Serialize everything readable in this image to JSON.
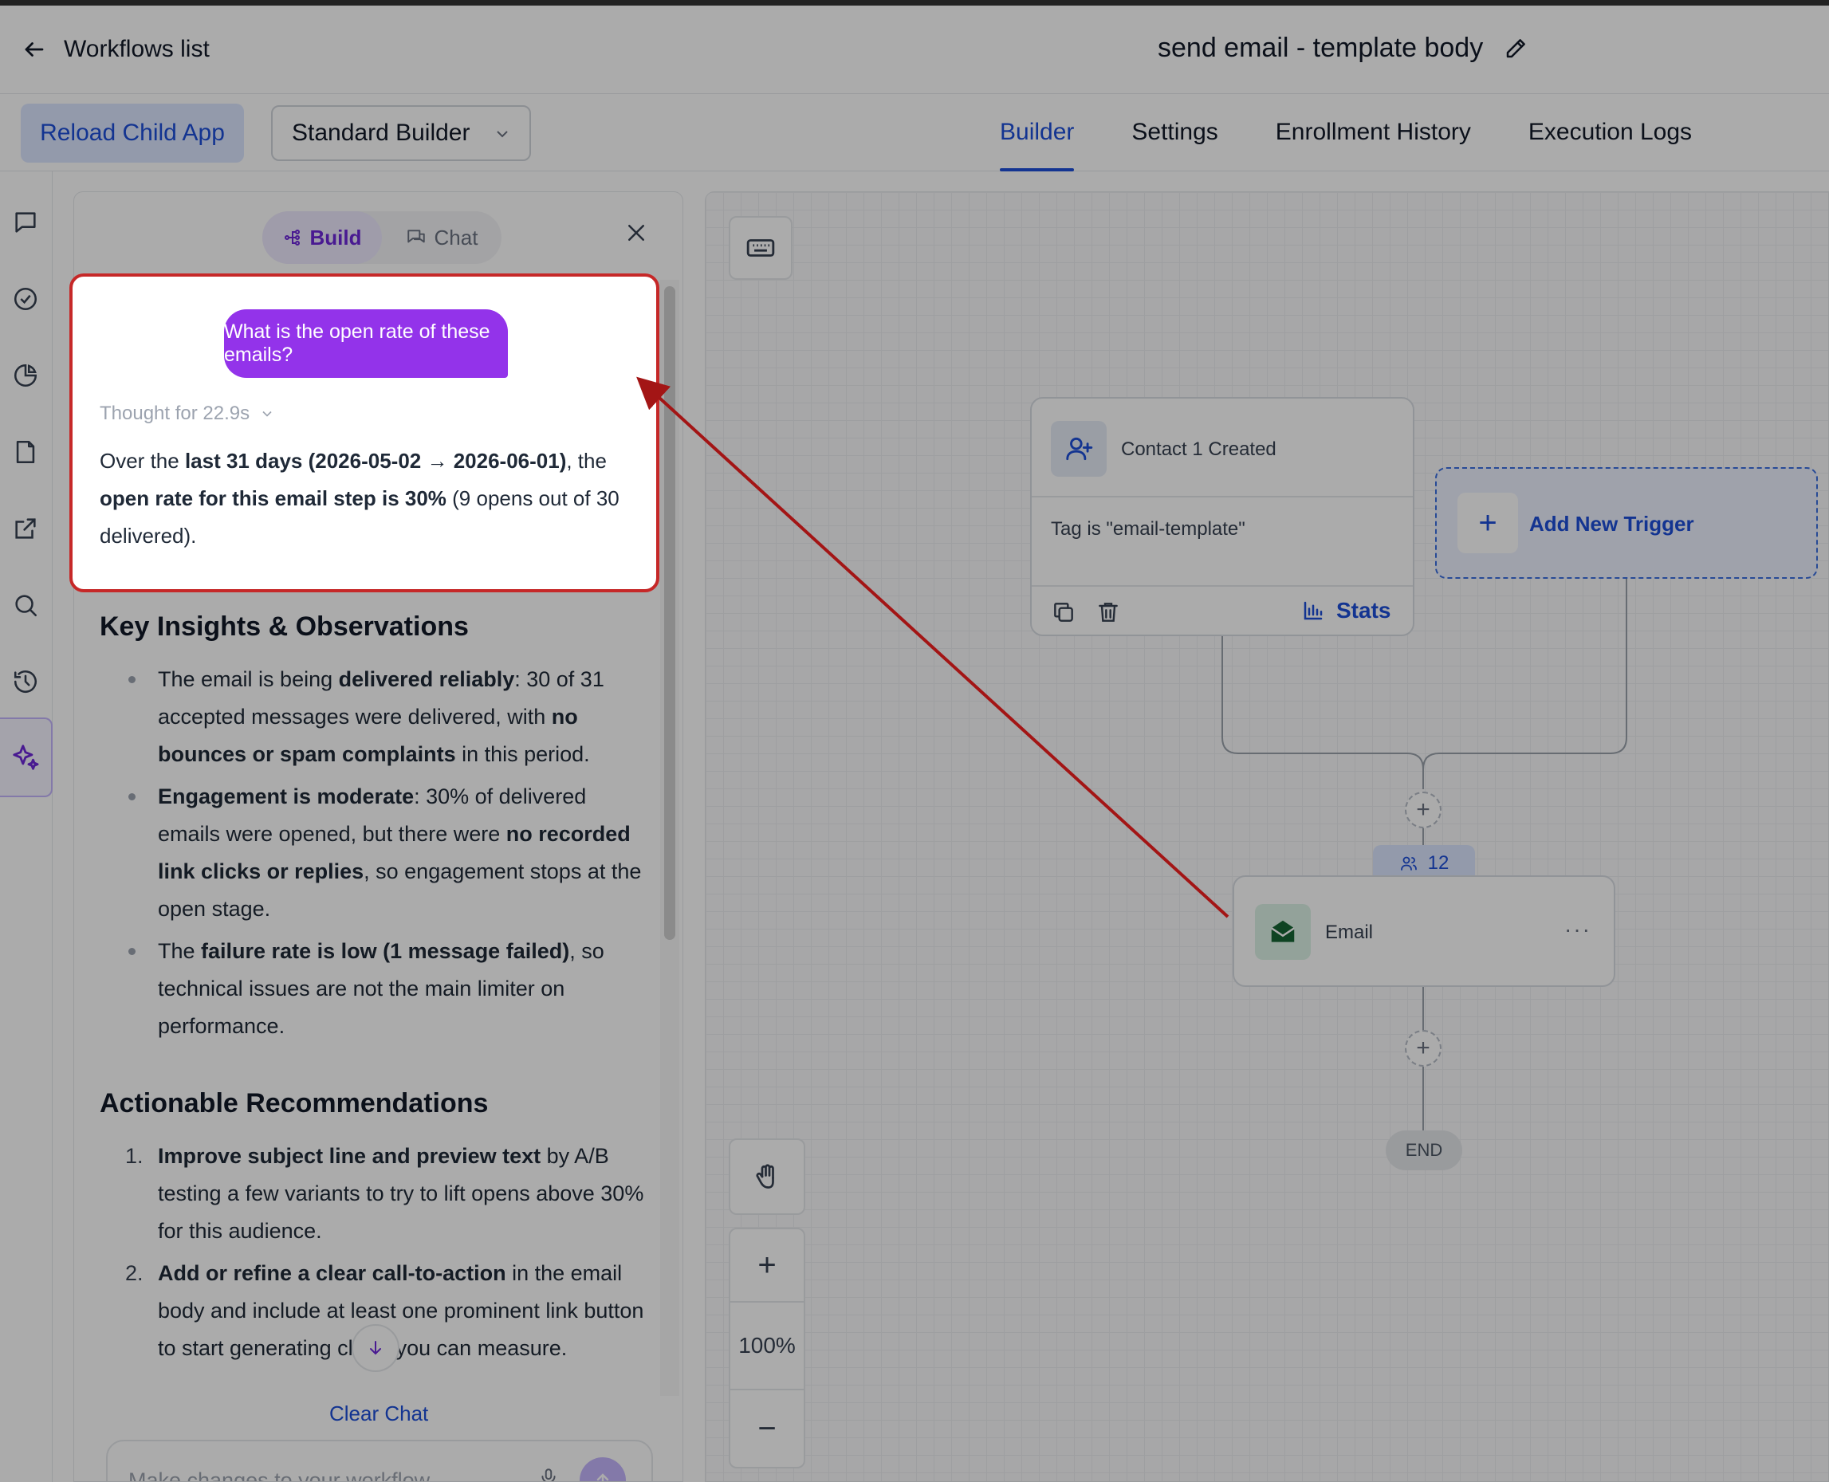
{
  "header": {
    "back_label": "Workflows list",
    "workflow_title": "send email - template body"
  },
  "toolbar": {
    "reload_label": "Reload Child App",
    "builder_select": "Standard Builder",
    "tabs": [
      {
        "label": "Builder",
        "active": true
      },
      {
        "label": "Settings",
        "active": false
      },
      {
        "label": "Enrollment History",
        "active": false
      },
      {
        "label": "Execution Logs",
        "active": false
      }
    ]
  },
  "left_rail": {
    "icons": [
      "chat-bubble-icon",
      "check-circle-icon",
      "pie-chart-icon",
      "document-icon",
      "external-link-icon",
      "search-icon",
      "history-icon",
      "sparkles-icon"
    ]
  },
  "assistant_panel": {
    "mode_build": "Build",
    "mode_chat": "Chat",
    "user_message": "What is the open rate of these emails?",
    "thought_label": "Thought for 22.9s",
    "answer": {
      "p1": "Over the ",
      "b1": "last 31 days (2026-05-02 → 2026-06-01)",
      "p2": ", the ",
      "b2": "open rate for this email step is 30%",
      "p3": " (9 opens out of 30 delivered)."
    },
    "insights_heading": "Key Insights & Observations",
    "insights": [
      {
        "pre": "The email is being ",
        "bold1": "delivered reliably",
        "mid": ": 30 of 31 accepted messages were delivered, with ",
        "bold2": "no bounces or spam complaints",
        "post": " in this period."
      },
      {
        "pre": "",
        "bold1": "Engagement is moderate",
        "mid": ": 30% of delivered emails were opened, but there were ",
        "bold2": "no recorded link clicks or replies",
        "post": ", so engagement stops at the open stage."
      },
      {
        "pre": "The ",
        "bold1": "failure rate is low (1 message failed)",
        "mid": ", so technical issues are not the main limiter on performance.",
        "bold2": "",
        "post": ""
      }
    ],
    "recs_heading": "Actionable Recommendations",
    "recommendations": [
      {
        "num": "1.",
        "bold": "Improve subject line and preview text",
        "text": " by A/B testing a few variants to try to lift opens above 30% for this audience."
      },
      {
        "num": "2.",
        "bold": "Add or refine a clear call-to-action",
        "text": " in the email body and include at least one prominent link button to start generating clicks you can measure."
      }
    ],
    "clear_chat": "Clear Chat",
    "composer_placeholder": "Make changes to your workflow..."
  },
  "canvas": {
    "trigger": {
      "name": "Contact 1 Created",
      "filter": "Tag is \"email-template\"",
      "stats_label": "Stats"
    },
    "add_trigger_label": "Add New Trigger",
    "enrolled_count": "12",
    "action": {
      "name": "Email"
    },
    "end_label": "END",
    "zoom_level": "100%"
  },
  "colors": {
    "accent_blue": "#1d4ed8",
    "accent_purple": "#9333ea",
    "highlight_red": "#c62828"
  }
}
